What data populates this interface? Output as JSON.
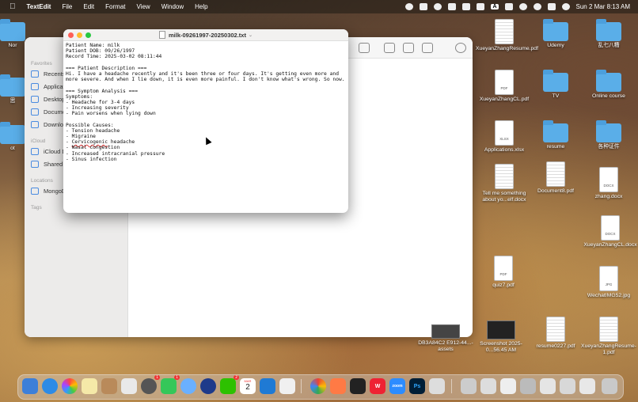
{
  "menubar": {
    "app": "TextEdit",
    "items": [
      "File",
      "Edit",
      "Format",
      "View",
      "Window",
      "Help"
    ],
    "a_badge": "A",
    "clock": "Sun 2 Mar  8:13 AM"
  },
  "finder": {
    "sections": {
      "favorites": "Favorites",
      "icloud": "iCloud",
      "locations": "Locations",
      "tags": "Tags"
    },
    "favorites": [
      "Recents",
      "Applications",
      "Desktop",
      "Documents",
      "Downloads"
    ],
    "icloud": [
      "iCloud Drive",
      "Shared"
    ],
    "locations": [
      "MongoDB"
    ]
  },
  "textedit": {
    "filename": "milk-09261997-20250302.txt",
    "lines": [
      "Patient Name: milk",
      "Patient DOB: 09/26/1997",
      "Record Time: 2025-03-02 08:11:44",
      "",
      "=== Patient Description ===",
      "Hi. I have a headache recently and it's been three or four days. It's getting even more and more severe. And when I lie down, it is even more painful. I don't know what's wrong. So now.",
      "",
      "=== Symptom Analysis ===",
      "Symptoms:",
      "- Headache for 3-4 days",
      "- Increasing severity",
      "- Pain worsens when lying down",
      "",
      "Possible Causes:",
      "- Tension headache",
      "- Migraine",
      "- Cervicogenic headache",
      "- Nasal congestion",
      "- Increased intracranial pressure",
      "- Sinus infection"
    ],
    "cervico_prefix": "- ",
    "cervico_word": "Cervicogenic",
    "cervico_suffix": " headache"
  },
  "desktop": {
    "left_labels": [
      "Nor",
      "思",
      "ot",
      "Mongo"
    ],
    "items": [
      {
        "label": "XueyanZhangResume.pdf",
        "tag": ""
      },
      {
        "label": "Udemy",
        "tag": ""
      },
      {
        "label": "乱七八糟",
        "tag": ""
      },
      {
        "label": "XueyanZhangCL.pdf",
        "tag": "PDF"
      },
      {
        "label": "TV",
        "tag": ""
      },
      {
        "label": "Online course",
        "tag": ""
      },
      {
        "label": "Applications.xlsx",
        "tag": "XLSX"
      },
      {
        "label": "resume",
        "tag": ""
      },
      {
        "label": "各种证件",
        "tag": ""
      },
      {
        "label": "Tell me something about yo...elf.docx",
        "tag": ""
      },
      {
        "label": "Document8.pdf",
        "tag": ""
      },
      {
        "label": "zhang.docx",
        "tag": "DOCX"
      },
      {
        "label": "XueyanZhangCL.docx",
        "tag": "DOCX"
      },
      {
        "label": "quiz7.pdf",
        "tag": "PDF"
      },
      {
        "label": "WechatIMG52.jpg",
        "tag": "JPG"
      },
      {
        "label": "DB3A84C2 E912-44...-assets",
        "tag": ""
      },
      {
        "label": "Screenshot 2025-0...56.45 AM",
        "tag": ""
      },
      {
        "label": "resume0227.pdf",
        "tag": ""
      },
      {
        "label": "XueyanZhangResume-1.pdf",
        "tag": ""
      }
    ]
  },
  "dock": {
    "calendar_month": "MAR",
    "calendar_day": "2",
    "badges": {
      "settings": "1",
      "messages": "1",
      "wechat": "2"
    },
    "zoom": "zoom",
    "ps": "Ps",
    "wps": "W"
  },
  "colors": {
    "folder": "#5aaee8",
    "close": "#fe5f57",
    "minimize": "#febc2e",
    "zoom": "#28c840"
  }
}
